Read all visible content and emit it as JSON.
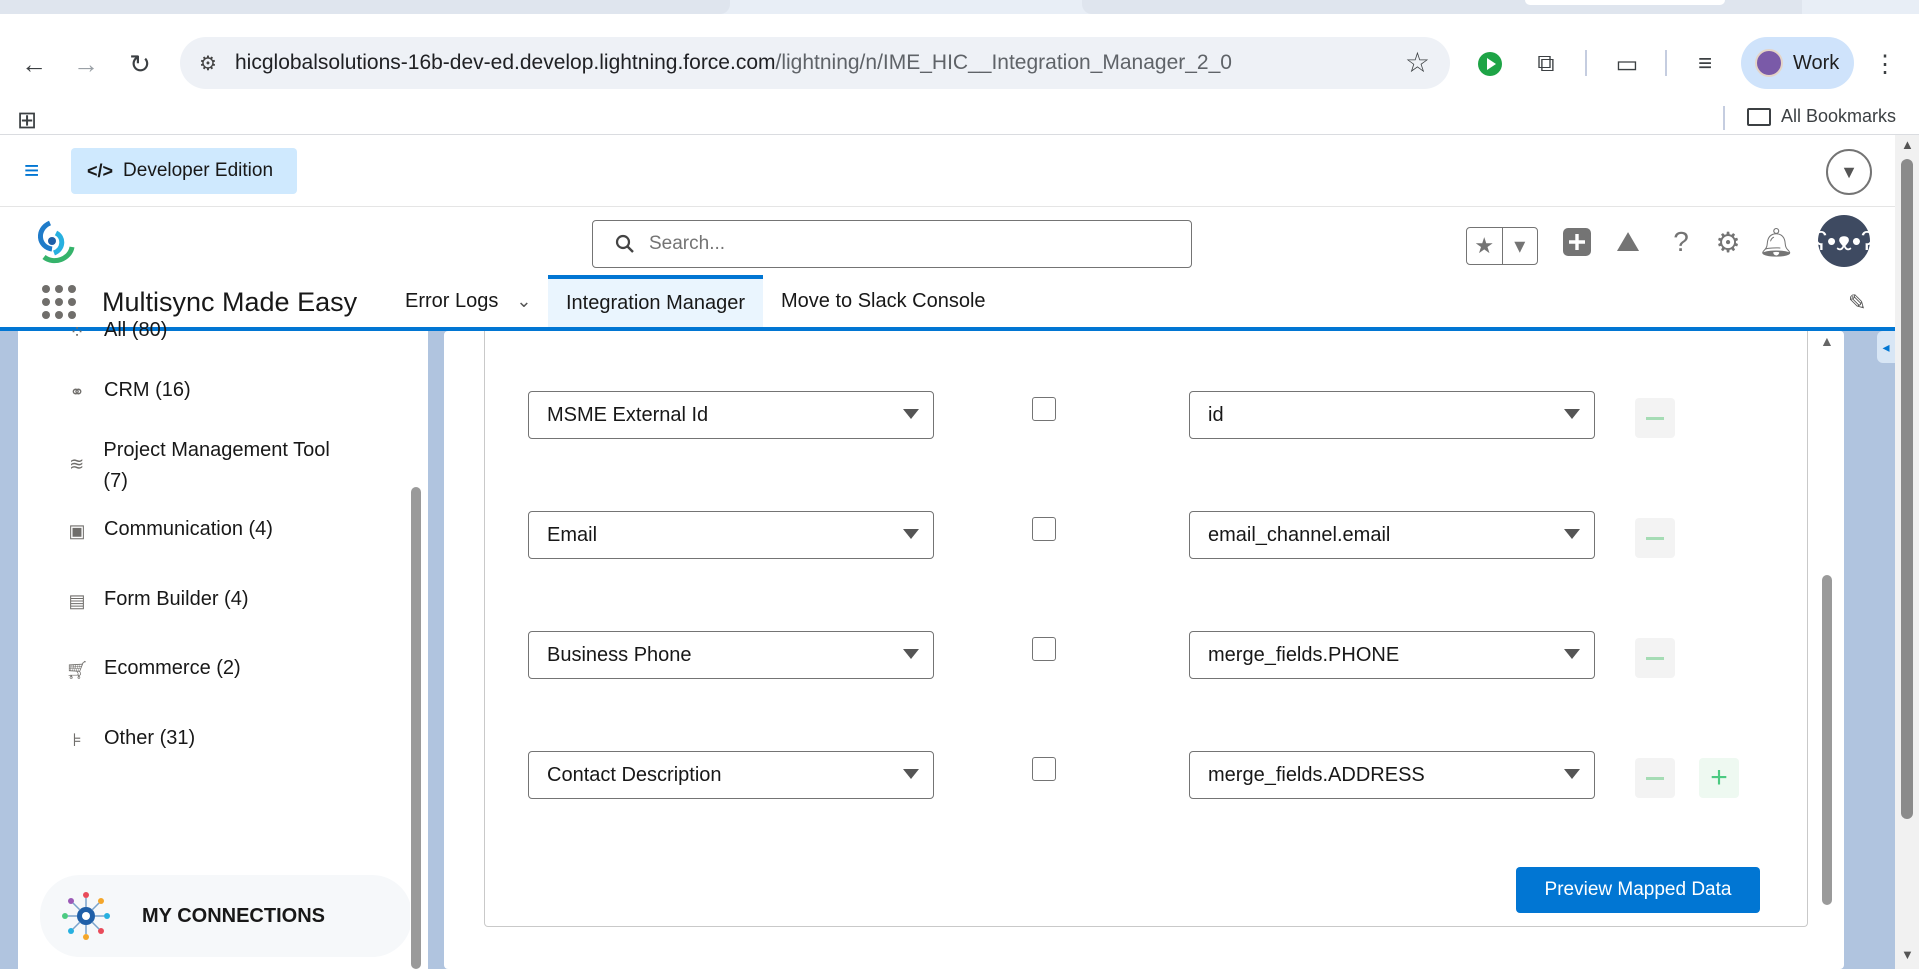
{
  "browser": {
    "url_host": "hicglobalsolutions-16b-dev-ed.develop.lightning.force.com",
    "url_path": "/lightning/n/IME_HIC__Integration_Manager_2_0",
    "profile_label": "Work",
    "bookmarks_label": "All Bookmarks"
  },
  "devbar": {
    "label": "Developer Edition",
    "code_glyph": "</>"
  },
  "header": {
    "search_placeholder": "Search..."
  },
  "appnav": {
    "app_name": "Multisync Made Easy",
    "tabs": [
      {
        "label": "Error Logs"
      },
      {
        "label": "Integration Manager"
      },
      {
        "label": "Move to Slack Console"
      }
    ]
  },
  "sidebar": {
    "items": [
      {
        "label": "All (80)"
      },
      {
        "label": "CRM (16)"
      },
      {
        "label": "Project Management Tool (7)"
      },
      {
        "label": "Communication (4)"
      },
      {
        "label": "Form Builder (4)"
      },
      {
        "label": "Ecommerce (2)"
      },
      {
        "label": "Other (31)"
      }
    ],
    "my_connections": "MY CONNECTIONS"
  },
  "mapping": {
    "rows": [
      {
        "source": "MSME External Id",
        "target": "id"
      },
      {
        "source": "Email",
        "target": "email_channel.email"
      },
      {
        "source": "Business Phone",
        "target": "merge_fields.PHONE"
      },
      {
        "source": "Contact Description",
        "target": "merge_fields.ADDRESS"
      }
    ],
    "preview_label": "Preview Mapped Data"
  },
  "colors": {
    "brand": "#0176d3",
    "accent_green": "#4bca81"
  }
}
